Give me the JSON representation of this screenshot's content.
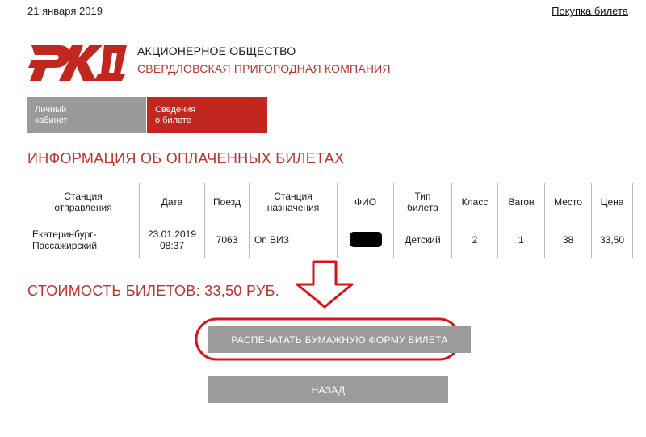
{
  "header": {
    "date": "21 января 2019",
    "buy_link": "Покупка билета"
  },
  "company": {
    "line1": "АКЦИОНЕРНОЕ ОБЩЕСТВО",
    "line2": "СВЕРДЛОВСКАЯ ПРИГОРОДНАЯ КОМПАНИЯ",
    "brand_color": "#c1271f"
  },
  "tabs": [
    {
      "line1": "Личный",
      "line2": "кабинет",
      "active": false
    },
    {
      "line1": "Сведения",
      "line2": "о билете",
      "active": true
    }
  ],
  "section_title": "ИНФОРМАЦИЯ ОБ ОПЛАЧЕННЫХ БИЛЕТАХ",
  "table": {
    "headers": [
      [
        "Станция",
        "отправления"
      ],
      [
        "Дата"
      ],
      [
        "Поезд"
      ],
      [
        "Станция",
        "назначения"
      ],
      [
        "ФИО"
      ],
      [
        "Тип",
        "билета"
      ],
      [
        "Класс"
      ],
      [
        "Вагон"
      ],
      [
        "Место"
      ],
      [
        "Цена"
      ]
    ],
    "row": {
      "departure": [
        "Екатеринбург-",
        "Пассажирский"
      ],
      "date": "23.01.2019",
      "time": "08:37",
      "train": "7063",
      "destination": "Оп ВИЗ",
      "ticket_type": "Детский",
      "class": "2",
      "car": "1",
      "seat": "38",
      "price": "33,50"
    }
  },
  "total": "СТОИМОСТЬ БИЛЕТОВ: 33,50 РУБ.",
  "buttons": {
    "print": "РАСПЕЧАТАТЬ БУМАЖНУЮ ФОРМУ БИЛЕТА",
    "back": "НАЗАД"
  },
  "icons": {
    "logo": "rzd-logo",
    "arrow": "down-arrow-annotation",
    "oval": "highlight-oval-annotation"
  }
}
